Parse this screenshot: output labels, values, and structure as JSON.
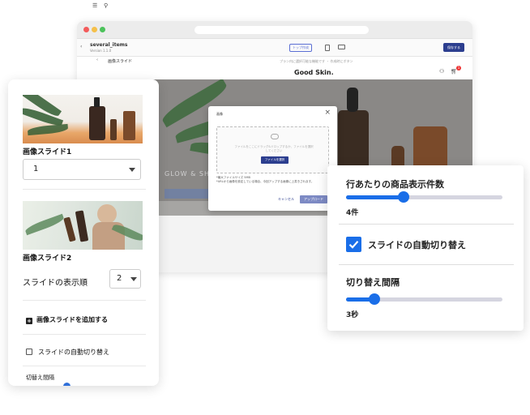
{
  "editor": {
    "title": "several_items",
    "version": "Version 1.1.0",
    "preview_button": "トップ作成",
    "save_button": "保存する",
    "section_label": "画像スライド",
    "announce": "プラン内に選択可能な機能です ・ 作成時にボタン",
    "side_heading": "画面"
  },
  "site": {
    "logo": "Good Skin.",
    "hero_text": "GLOW & SHINE",
    "cart_count": "1"
  },
  "modal": {
    "title": "画像",
    "drop_text": "ファイルをここにドラッグ&ドロップするか、ファイルを選択してください",
    "select_button": "ファイルを選択",
    "note_line1": "*最大ファイルサイズ 5MB",
    "note_line2": "*URLから画像を設定している場合、今回アップする画像に上書きされます。",
    "cancel": "キャンセル",
    "upload": "アップロード"
  },
  "left_panel": {
    "slide1_label": "画像スライド1",
    "slide1_value": "1",
    "slide2_label": "画像スライド2",
    "order_label": "スライドの表示順",
    "order_value": "2",
    "add_slide": "画像スライドを追加する",
    "auto_switch": "スライドの自動切り替え",
    "interval_label": "切替え間隔"
  },
  "right_panel": {
    "items_label": "行あたりの商品表示件数",
    "items_value": "4件",
    "items_fraction": 0.37,
    "auto_switch_label": "スライドの自動切り替え",
    "auto_switch_checked": true,
    "interval_label": "切り替え間隔",
    "interval_value": "3秒",
    "interval_fraction": 0.18
  },
  "colors": {
    "accent": "#1a6ee8",
    "save_button": "#2c3e8f"
  }
}
